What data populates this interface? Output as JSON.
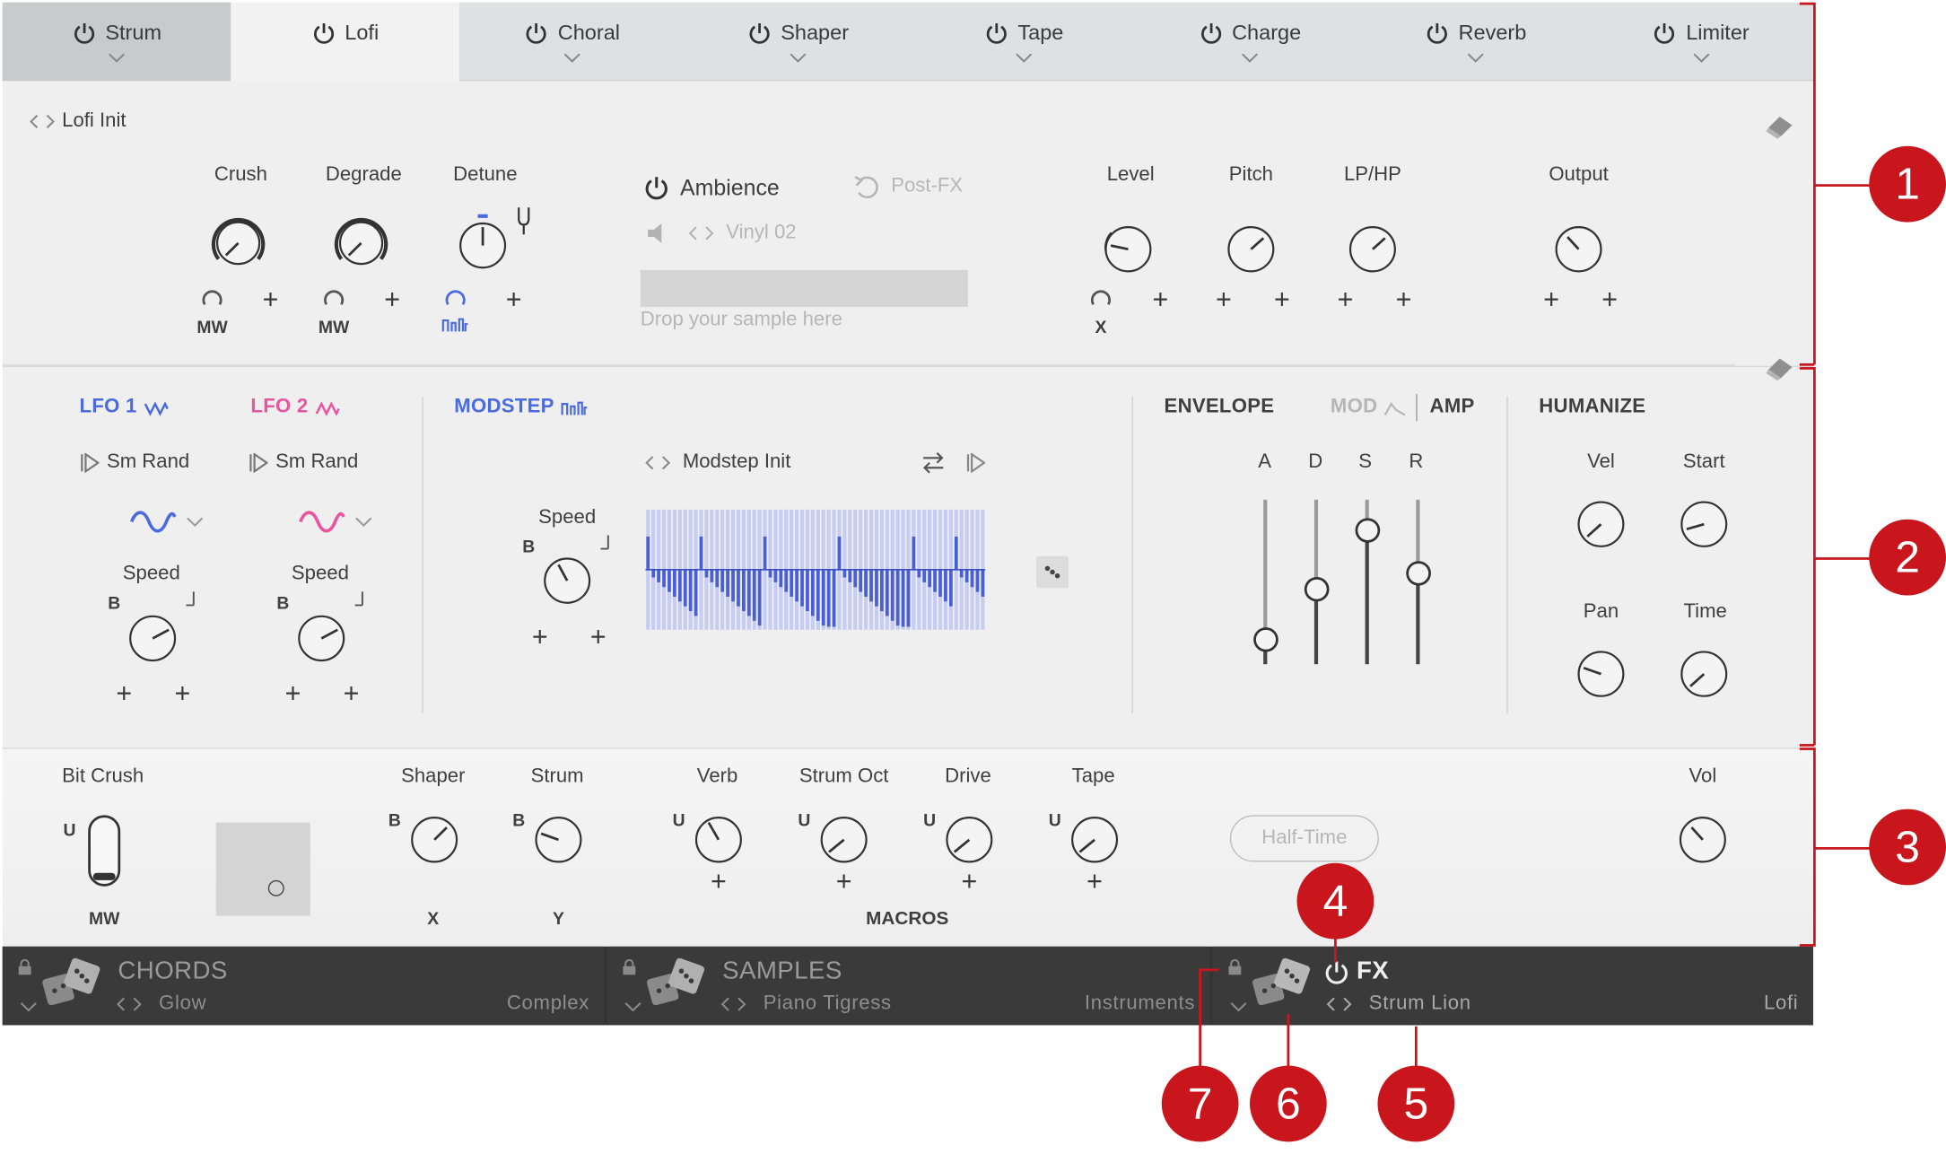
{
  "colors": {
    "accent_red": "#c8161c",
    "lfo1_blue": "#4a6be0",
    "lfo2_pink": "#e8559e",
    "bar_bg": "#333333"
  },
  "tabs": [
    {
      "label": "Strum",
      "icon": "power-icon"
    },
    {
      "label": "Lofi",
      "icon": "power-icon"
    },
    {
      "label": "Choral",
      "icon": "power-icon"
    },
    {
      "label": "Shaper",
      "icon": "power-icon"
    },
    {
      "label": "Tape",
      "icon": "power-icon"
    },
    {
      "label": "Charge",
      "icon": "power-icon"
    },
    {
      "label": "Reverb",
      "icon": "power-icon"
    },
    {
      "label": "Limiter",
      "icon": "power-icon"
    }
  ],
  "lofi": {
    "preset": "Lofi Init",
    "crush": "Crush",
    "degrade": "Degrade",
    "detune": "Detune",
    "mw": "MW",
    "ambience": "Ambience",
    "postfx": "Post-FX",
    "sample": "Vinyl 02",
    "drop": "Drop your sample here",
    "level": "Level",
    "pitch": "Pitch",
    "lphp": "LP/HP",
    "output": "Output",
    "x": "X"
  },
  "mod": {
    "lfo1": "LFO 1",
    "lfo2": "LFO 2",
    "smrand": "Sm Rand",
    "speed": "Speed",
    "b": "B",
    "modstep": "MODSTEP",
    "modstep_preset": "Modstep Init",
    "envelope": "ENVELOPE",
    "mod": "MOD",
    "amp": "AMP",
    "adsr": [
      "A",
      "D",
      "S",
      "R"
    ],
    "humanize": "HUMANIZE",
    "vel": "Vel",
    "start": "Start",
    "pan": "Pan",
    "time": "Time"
  },
  "macros": {
    "bitcrush": "Bit Crush",
    "u": "U",
    "mw": "MW",
    "shaper": "Shaper",
    "strum": "Strum",
    "x": "X",
    "y": "Y",
    "b": "B",
    "verb": "Verb",
    "strumoct": "Strum Oct",
    "drive": "Drive",
    "tape": "Tape",
    "title": "MACROS",
    "halftime": "Half-Time",
    "vol": "Vol"
  },
  "bottom": [
    {
      "title": "CHORDS",
      "preset": "Glow",
      "category": "Complex"
    },
    {
      "title": "SAMPLES",
      "preset": "Piano Tigress",
      "category": "Instruments"
    },
    {
      "title": "FX",
      "preset": "Strum Lion",
      "category": "Lofi"
    }
  ],
  "callouts": [
    "1",
    "2",
    "3",
    "4",
    "5",
    "6",
    "7"
  ]
}
